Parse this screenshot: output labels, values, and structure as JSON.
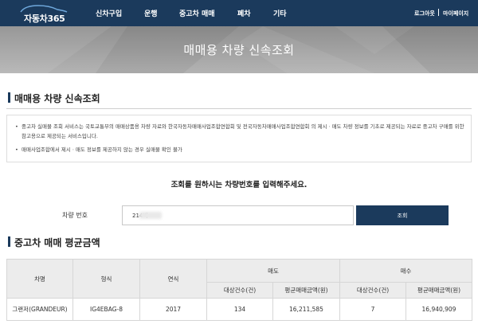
{
  "brand": {
    "logo_text": "자동차365",
    "logo_icon": "car-outline-icon"
  },
  "nav": {
    "menu": [
      {
        "id": "new-car",
        "label": "신차구입"
      },
      {
        "id": "operation",
        "label": "운행"
      },
      {
        "id": "used-car",
        "label": "중고차 매매"
      },
      {
        "id": "scrap",
        "label": "폐차"
      },
      {
        "id": "etc",
        "label": "기타"
      }
    ],
    "logout_label": "로그아웃",
    "mypage_label": "마이페이지"
  },
  "banner": {
    "title": "매매용 차량 신속조회"
  },
  "section1": {
    "title": "매매용 차량 신속조회"
  },
  "notice": {
    "items": [
      "중고차 실매물 조회 서비스는 국토교통부의 매매상품용 차량 자료와 한국자동차매매사업조합연합회 및 전국자동차매매사업조합연합회 의 제시ㆍ매도 차량 정보를 기초로 제공되는 자료로 중고차 구매를 위한 참고용으로 제공되는 서비스입니다.",
      "매매사업조합에서 제시ㆍ매도 정보를 제공하지 않는 경우 실매물 확인 불가"
    ]
  },
  "search": {
    "prompt": "조회를 원하시는 차량번호를 입력해주세요.",
    "label": "차량 번호",
    "value": "214버",
    "button_label": "조회"
  },
  "section2": {
    "title": "중고차 매매 평균금액"
  },
  "table": {
    "headers": {
      "model": "차명",
      "type": "형식",
      "year": "연식",
      "sell": "매도",
      "buy": "매수",
      "count": "대상건수(건)",
      "avg_price": "평균매매금액(원)"
    },
    "rows": [
      {
        "model": "그랜저(GRANDEUR)",
        "type": "IG4EBAG-8",
        "year": "2017",
        "sell_count": "134",
        "sell_avg": "16,211,585",
        "buy_count": "7",
        "buy_avg": "16,940,909"
      }
    ]
  },
  "colors": {
    "navy": "#1b3a5c",
    "header_bg": "#ececec",
    "banner_gray": "#a3a3a3"
  }
}
